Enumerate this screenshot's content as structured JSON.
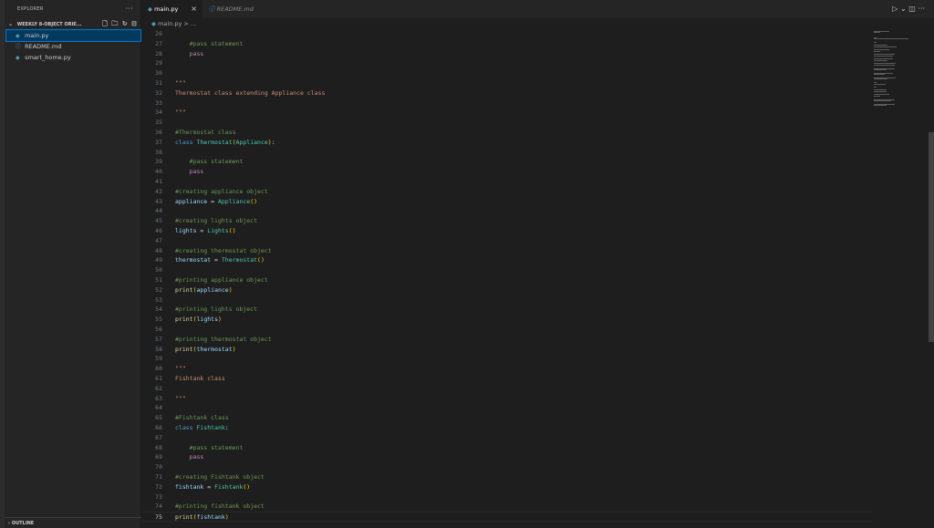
{
  "sidebar": {
    "title": "EXPLORER",
    "folder": "WEEKLY 8-OBJECT ORIE...",
    "files": [
      {
        "name": "main.py",
        "type": "py"
      },
      {
        "name": "README.md",
        "type": "info"
      },
      {
        "name": "smart_home.py",
        "type": "py"
      }
    ],
    "outline": "OUTLINE"
  },
  "tabs": [
    {
      "label": "main.py",
      "active": true
    },
    {
      "label": "README.md",
      "active": false
    }
  ],
  "breadcrumb": "main.py > ...",
  "code": [
    {
      "n": "26",
      "tokens": []
    },
    {
      "n": "27",
      "tokens": [
        {
          "t": "    #pass statement",
          "c": "c-comment"
        }
      ]
    },
    {
      "n": "28",
      "tokens": [
        {
          "t": "    pass",
          "c": "c-kw2"
        }
      ]
    },
    {
      "n": "29",
      "tokens": []
    },
    {
      "n": "30",
      "tokens": []
    },
    {
      "n": "31",
      "tokens": [
        {
          "t": "\"\"\"",
          "c": "c-str"
        }
      ]
    },
    {
      "n": "32",
      "tokens": [
        {
          "t": "Thermostat class extending Appliance class",
          "c": "c-str"
        }
      ]
    },
    {
      "n": "33",
      "tokens": []
    },
    {
      "n": "34",
      "tokens": [
        {
          "t": "\"\"\"",
          "c": "c-str"
        }
      ]
    },
    {
      "n": "35",
      "tokens": []
    },
    {
      "n": "36",
      "tokens": [
        {
          "t": "#Thermostat class",
          "c": "c-comment"
        }
      ]
    },
    {
      "n": "37",
      "tokens": [
        {
          "t": "class ",
          "c": "c-kw"
        },
        {
          "t": "Thermostat",
          "c": "c-class"
        },
        {
          "t": "(",
          "c": "c-paren"
        },
        {
          "t": "Appliance",
          "c": "c-class"
        },
        {
          "t": ")",
          "c": "c-paren"
        },
        {
          "t": ":",
          "c": "c-plain"
        }
      ]
    },
    {
      "n": "38",
      "tokens": []
    },
    {
      "n": "39",
      "tokens": [
        {
          "t": "    #pass statement",
          "c": "c-comment"
        }
      ]
    },
    {
      "n": "40",
      "tokens": [
        {
          "t": "    pass",
          "c": "c-kw2"
        }
      ]
    },
    {
      "n": "41",
      "tokens": []
    },
    {
      "n": "42",
      "tokens": [
        {
          "t": "#creating appliance object",
          "c": "c-comment"
        }
      ]
    },
    {
      "n": "43",
      "tokens": [
        {
          "t": "appliance",
          "c": "c-var"
        },
        {
          "t": " = ",
          "c": "c-plain"
        },
        {
          "t": "Appliance",
          "c": "c-class"
        },
        {
          "t": "()",
          "c": "c-paren"
        }
      ]
    },
    {
      "n": "44",
      "tokens": []
    },
    {
      "n": "45",
      "tokens": [
        {
          "t": "#creating lights object",
          "c": "c-comment"
        }
      ]
    },
    {
      "n": "46",
      "tokens": [
        {
          "t": "lights",
          "c": "c-var"
        },
        {
          "t": " = ",
          "c": "c-plain"
        },
        {
          "t": "Lights",
          "c": "c-class"
        },
        {
          "t": "()",
          "c": "c-paren"
        }
      ]
    },
    {
      "n": "47",
      "tokens": []
    },
    {
      "n": "48",
      "tokens": [
        {
          "t": "#creating thermostat object",
          "c": "c-comment"
        }
      ]
    },
    {
      "n": "49",
      "tokens": [
        {
          "t": "thermostat",
          "c": "c-var"
        },
        {
          "t": " = ",
          "c": "c-plain"
        },
        {
          "t": "Thermostat",
          "c": "c-class"
        },
        {
          "t": "()",
          "c": "c-paren"
        }
      ]
    },
    {
      "n": "50",
      "tokens": []
    },
    {
      "n": "51",
      "tokens": [
        {
          "t": "#printing appliance object",
          "c": "c-comment"
        }
      ]
    },
    {
      "n": "52",
      "tokens": [
        {
          "t": "print",
          "c": "c-func"
        },
        {
          "t": "(",
          "c": "c-paren"
        },
        {
          "t": "appliance",
          "c": "c-var"
        },
        {
          "t": ")",
          "c": "c-paren"
        }
      ]
    },
    {
      "n": "53",
      "tokens": []
    },
    {
      "n": "54",
      "tokens": [
        {
          "t": "#printing lights object",
          "c": "c-comment"
        }
      ]
    },
    {
      "n": "55",
      "tokens": [
        {
          "t": "print",
          "c": "c-func"
        },
        {
          "t": "(",
          "c": "c-paren"
        },
        {
          "t": "lights",
          "c": "c-var"
        },
        {
          "t": ")",
          "c": "c-paren"
        }
      ]
    },
    {
      "n": "56",
      "tokens": []
    },
    {
      "n": "57",
      "tokens": [
        {
          "t": "#printing thermostat object",
          "c": "c-comment"
        }
      ]
    },
    {
      "n": "58",
      "tokens": [
        {
          "t": "print",
          "c": "c-func"
        },
        {
          "t": "(",
          "c": "c-paren"
        },
        {
          "t": "thermostat",
          "c": "c-var"
        },
        {
          "t": ")",
          "c": "c-paren"
        }
      ]
    },
    {
      "n": "59",
      "tokens": []
    },
    {
      "n": "60",
      "tokens": [
        {
          "t": "\"\"\"",
          "c": "c-str"
        }
      ]
    },
    {
      "n": "61",
      "tokens": [
        {
          "t": "Fishtank class",
          "c": "c-str"
        }
      ]
    },
    {
      "n": "62",
      "tokens": []
    },
    {
      "n": "63",
      "tokens": [
        {
          "t": "\"\"\"",
          "c": "c-str"
        }
      ]
    },
    {
      "n": "64",
      "tokens": []
    },
    {
      "n": "65",
      "tokens": [
        {
          "t": "#Fishtank class",
          "c": "c-comment"
        }
      ]
    },
    {
      "n": "66",
      "tokens": [
        {
          "t": "class ",
          "c": "c-kw"
        },
        {
          "t": "Fishtank",
          "c": "c-class"
        },
        {
          "t": ":",
          "c": "c-plain"
        }
      ]
    },
    {
      "n": "67",
      "tokens": []
    },
    {
      "n": "68",
      "tokens": [
        {
          "t": "    #pass statement",
          "c": "c-comment"
        }
      ]
    },
    {
      "n": "69",
      "tokens": [
        {
          "t": "    pass",
          "c": "c-kw2"
        }
      ]
    },
    {
      "n": "70",
      "tokens": []
    },
    {
      "n": "71",
      "tokens": [
        {
          "t": "#creating Fishtank object",
          "c": "c-comment"
        }
      ]
    },
    {
      "n": "72",
      "tokens": [
        {
          "t": "fishtank",
          "c": "c-var"
        },
        {
          "t": " = ",
          "c": "c-plain"
        },
        {
          "t": "Fishtank",
          "c": "c-class"
        },
        {
          "t": "()",
          "c": "c-paren"
        }
      ]
    },
    {
      "n": "73",
      "tokens": []
    },
    {
      "n": "74",
      "tokens": [
        {
          "t": "#printing fishtank object",
          "c": "c-comment"
        }
      ]
    },
    {
      "n": "75",
      "tokens": [
        {
          "t": "print",
          "c": "c-func"
        },
        {
          "t": "(",
          "c": "c-paren"
        },
        {
          "t": "fishtank",
          "c": "c-var"
        },
        {
          "t": ")",
          "c": "c-paren"
        }
      ],
      "current": true
    }
  ]
}
